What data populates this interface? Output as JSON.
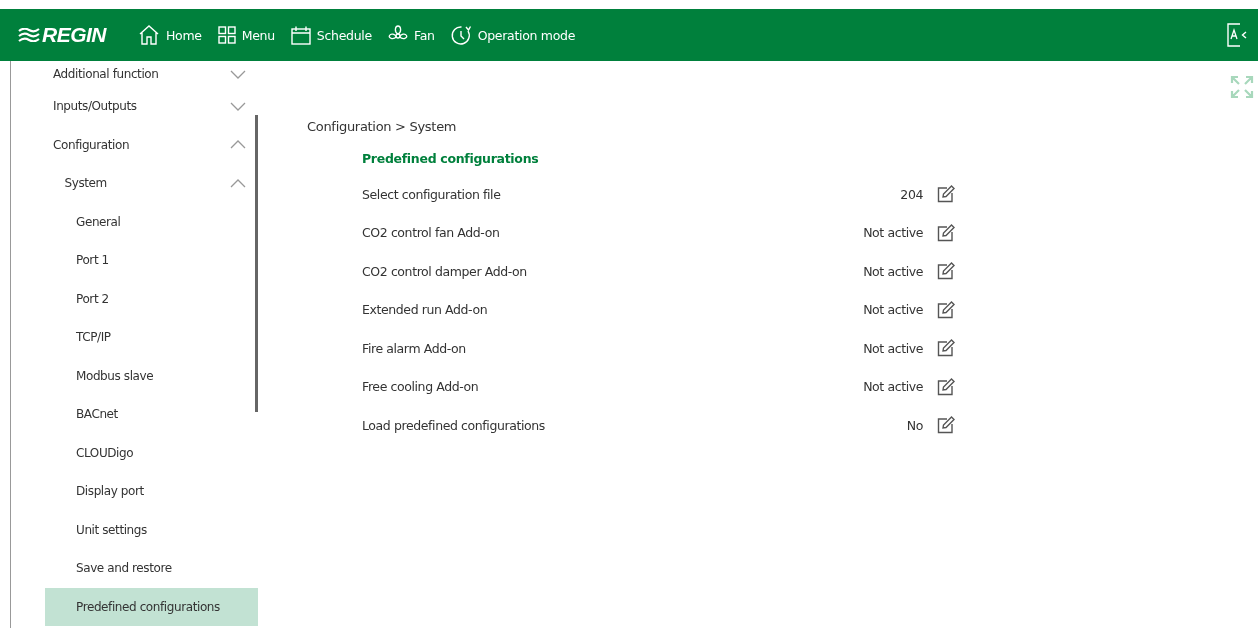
{
  "header": {
    "logo": "REGIN",
    "nav": [
      {
        "kind": "home",
        "label": "Home"
      },
      {
        "kind": "menu",
        "label": "Menu"
      },
      {
        "kind": "schedule",
        "label": "Schedule"
      },
      {
        "kind": "fan",
        "label": "Fan"
      },
      {
        "kind": "mode",
        "label": "Operation mode"
      }
    ]
  },
  "sidebar": {
    "items": [
      {
        "label": "Additional function",
        "expanded": false,
        "selected": false
      },
      {
        "label": "Inputs/Outputs",
        "expanded": false,
        "selected": false
      },
      {
        "label": "Configuration",
        "expanded": true,
        "selected": false,
        "children": [
          {
            "label": "System",
            "expanded": true,
            "selected": false,
            "children": [
              {
                "label": "General",
                "selected": false
              },
              {
                "label": "Port 1",
                "selected": false
              },
              {
                "label": "Port 2",
                "selected": false
              },
              {
                "label": "TCP/IP",
                "selected": false
              },
              {
                "label": "Modbus slave",
                "selected": false
              },
              {
                "label": "BACnet",
                "selected": false
              },
              {
                "label": "CLOUDigo",
                "selected": false
              },
              {
                "label": "Display port",
                "selected": false
              },
              {
                "label": "Unit settings",
                "selected": false
              },
              {
                "label": "Save and restore",
                "selected": false
              },
              {
                "label": "Predefined configurations",
                "selected": true
              }
            ]
          }
        ]
      }
    ]
  },
  "breadcrumb": "Configuration > System",
  "section_title": "Predefined configurations",
  "settings": [
    {
      "label": "Select configuration file",
      "value": "204"
    },
    {
      "label": "CO2 control fan Add-on",
      "value": "Not active"
    },
    {
      "label": "CO2 control damper Add-on",
      "value": "Not active"
    },
    {
      "label": "Extended run Add-on",
      "value": "Not active"
    },
    {
      "label": "Fire alarm Add-on",
      "value": "Not active"
    },
    {
      "label": "Free cooling Add-on",
      "value": "Not active"
    },
    {
      "label": "Load predefined configurations",
      "value": "No"
    }
  ]
}
